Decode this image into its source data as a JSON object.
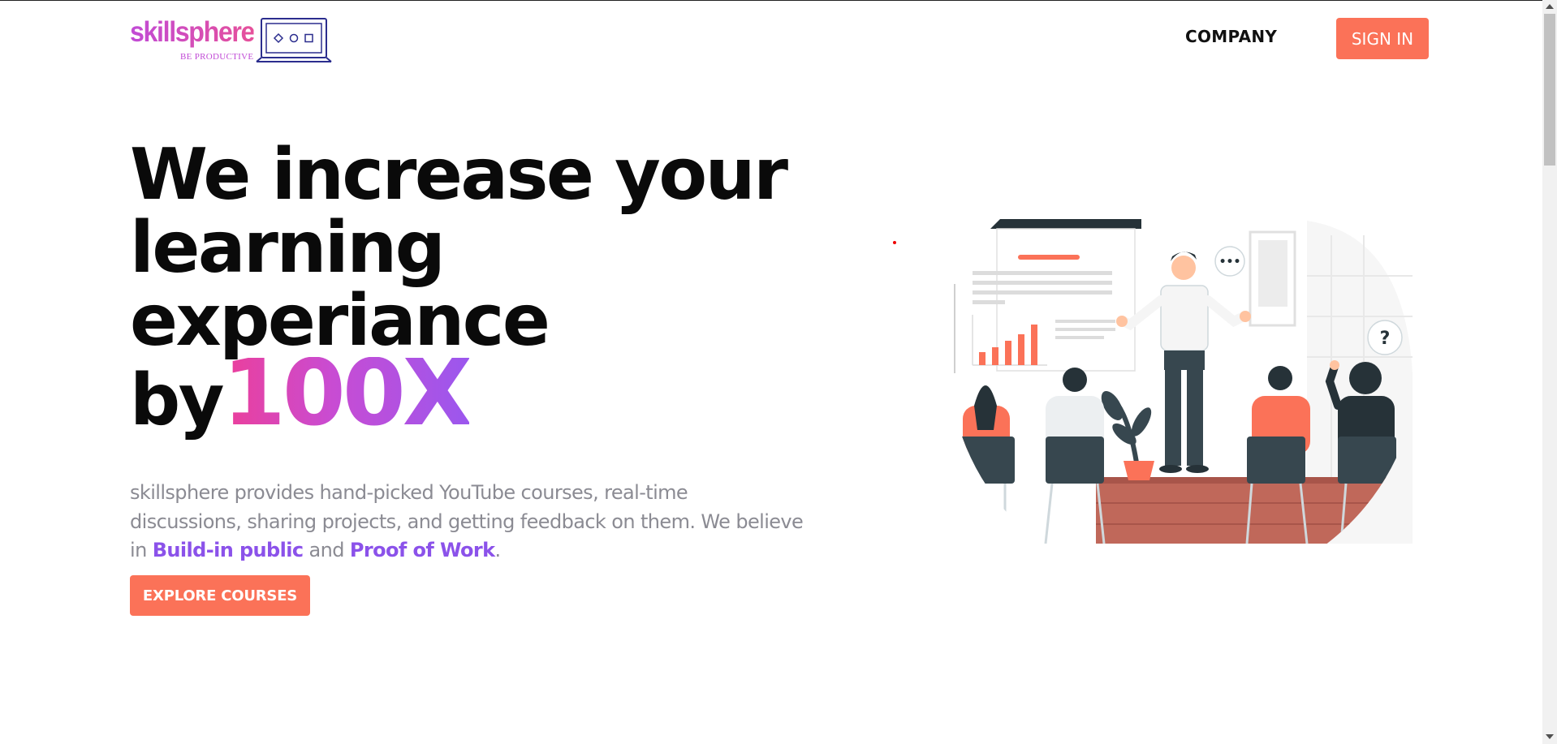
{
  "brand": {
    "name": "skillsphere",
    "tagline": "BE PRODUCTIVE",
    "gradient": [
      "#c14bd6",
      "#e6509a"
    ]
  },
  "nav": {
    "company_label": "COMPANY",
    "signin_label": "SIGN IN"
  },
  "hero": {
    "headline_lines": [
      "We increase your",
      "learning",
      "experiance"
    ],
    "headline_by": "by",
    "headline_accent": "100X",
    "description_parts": [
      "skillsphere provides hand-picked YouTube courses, real-time discussions, sharing projects, and getting feedback on them. We believe in ",
      "Build-in public",
      " and ",
      "Proof of Work",
      "."
    ],
    "cta_label": "EXPLORE COURSES"
  },
  "colors": {
    "accent": "#fb7258",
    "highlight": "#8b52ea",
    "body_text": "#8b8b93",
    "dark": "#263238",
    "teal": "#37474f"
  },
  "illustration": {
    "speech_bubble": "•••",
    "question_mark": "?"
  }
}
